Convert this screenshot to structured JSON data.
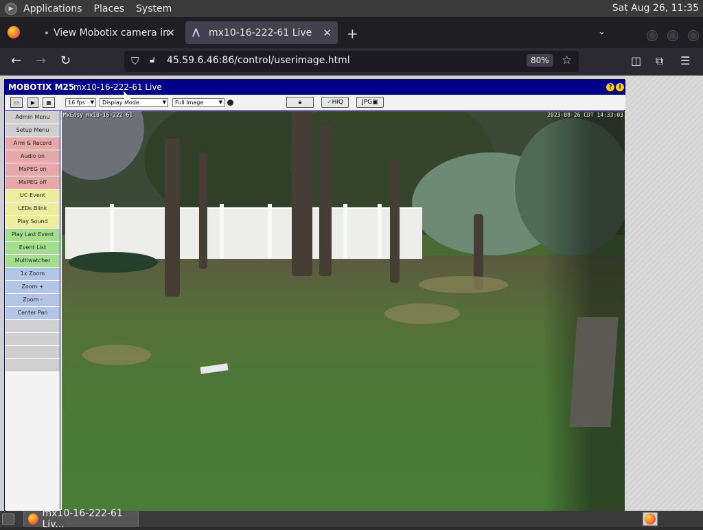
{
  "top_panel": {
    "menus": [
      "Applications",
      "Places",
      "System"
    ],
    "clock": "Sat Aug 26, 11:35"
  },
  "browser": {
    "tabs": [
      {
        "label": "View Mobotix camera in Unit",
        "active": false
      },
      {
        "label": "mx10-16-222-61 Live",
        "active": true
      }
    ],
    "url": "45.59.6.46:86/control/userimage.html",
    "zoom": "80%"
  },
  "camera": {
    "brand": "MOBOTIX M25",
    "title": "mx10-16-222-61 Live",
    "help_icons": [
      "?",
      "i"
    ],
    "toolbar": {
      "fps": "16 fps",
      "display_mode": "Display Mode",
      "image_size": "Full Image",
      "hiq_label": "HiQ",
      "jpg_label": "JPG"
    },
    "overlay_left": "MxEasy mx10-16-222-61",
    "overlay_right": "2023-08-26 CDT 14:33:03",
    "sidebar": [
      {
        "label": "Admin Menu",
        "color": "grey"
      },
      {
        "label": "Setup Menu",
        "color": "grey"
      },
      {
        "label": "Arm & Record",
        "color": "red"
      },
      {
        "label": "Audio on",
        "color": "red"
      },
      {
        "label": "MxPEG on",
        "color": "red"
      },
      {
        "label": "MxPEG off",
        "color": "red"
      },
      {
        "label": "UC Event",
        "color": "yellow"
      },
      {
        "label": "LEDs Blink",
        "color": "yellow"
      },
      {
        "label": "Play Sound",
        "color": "yellow"
      },
      {
        "label": "Play Last Event",
        "color": "green"
      },
      {
        "label": "Event List",
        "color": "green"
      },
      {
        "label": "Multiwatcher",
        "color": "green"
      },
      {
        "label": "1x Zoom",
        "color": "blue"
      },
      {
        "label": "Zoom +",
        "color": "blue"
      },
      {
        "label": "Zoom -",
        "color": "blue"
      },
      {
        "label": "Center Pan",
        "color": "blue"
      },
      {
        "label": "",
        "color": "empty"
      },
      {
        "label": "",
        "color": "empty"
      },
      {
        "label": "",
        "color": "empty"
      },
      {
        "label": "",
        "color": "empty"
      }
    ]
  },
  "taskbar": {
    "window_label": "mx10-16-222-61 Liv..."
  }
}
